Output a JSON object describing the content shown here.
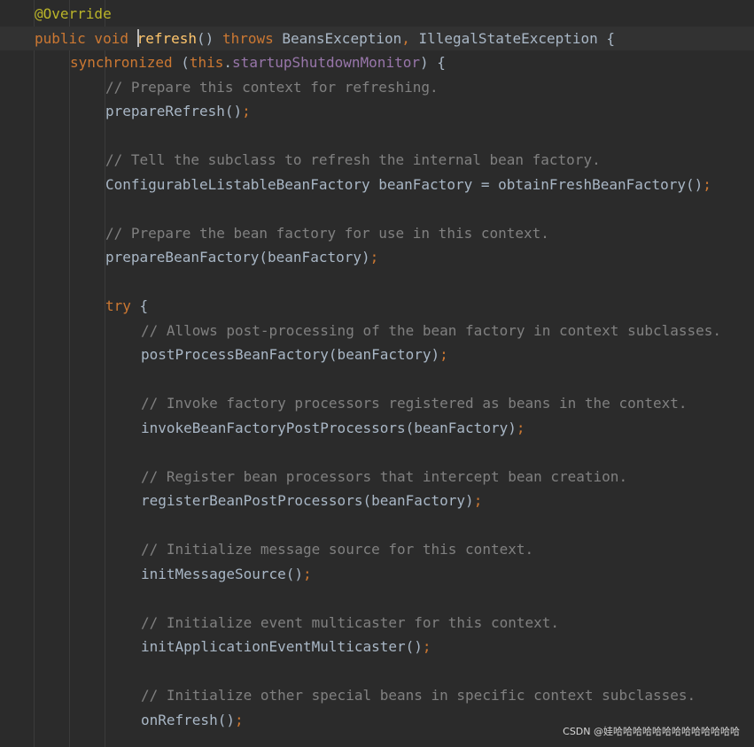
{
  "editor": {
    "theme_colors": {
      "background": "#2b2b2b",
      "current_line": "#323232",
      "plain": "#a9b7c6",
      "keyword": "#cc7832",
      "annotation": "#bbb529",
      "method_declaration": "#ffc66d",
      "field": "#9876aa",
      "comment": "#808080"
    },
    "lines": [
      {
        "indent": 1,
        "tokens": [
          {
            "t": "@Override",
            "k": "annotation"
          }
        ]
      },
      {
        "indent": 1,
        "current": true,
        "tokens": [
          {
            "t": "public void ",
            "k": "keyword"
          },
          {
            "t": "",
            "k": "caret"
          },
          {
            "t": "refresh",
            "k": "method-decl"
          },
          {
            "t": "() ",
            "k": "plain"
          },
          {
            "t": "throws ",
            "k": "keyword"
          },
          {
            "t": "BeansException",
            "k": "plain"
          },
          {
            "t": ", ",
            "k": "punct"
          },
          {
            "t": "IllegalStateException {",
            "k": "plain"
          }
        ]
      },
      {
        "indent": 2,
        "tokens": [
          {
            "t": "synchronized ",
            "k": "keyword"
          },
          {
            "t": "(",
            "k": "plain"
          },
          {
            "t": "this",
            "k": "keyword"
          },
          {
            "t": ".",
            "k": "plain"
          },
          {
            "t": "startupShutdownMonitor",
            "k": "field"
          },
          {
            "t": ") {",
            "k": "plain"
          }
        ]
      },
      {
        "indent": 3,
        "tokens": [
          {
            "t": "// Prepare this context for refreshing.",
            "k": "comment"
          }
        ]
      },
      {
        "indent": 3,
        "tokens": [
          {
            "t": "prepareRefresh()",
            "k": "plain"
          },
          {
            "t": ";",
            "k": "punct"
          }
        ]
      },
      {
        "indent": 3,
        "tokens": []
      },
      {
        "indent": 3,
        "tokens": [
          {
            "t": "// Tell the subclass to refresh the internal bean factory.",
            "k": "comment"
          }
        ]
      },
      {
        "indent": 3,
        "tokens": [
          {
            "t": "ConfigurableListableBeanFactory beanFactory = obtainFreshBeanFactory()",
            "k": "plain"
          },
          {
            "t": ";",
            "k": "punct"
          }
        ]
      },
      {
        "indent": 3,
        "tokens": []
      },
      {
        "indent": 3,
        "tokens": [
          {
            "t": "// Prepare the bean factory for use in this context.",
            "k": "comment"
          }
        ]
      },
      {
        "indent": 3,
        "tokens": [
          {
            "t": "prepareBeanFactory(beanFactory)",
            "k": "plain"
          },
          {
            "t": ";",
            "k": "punct"
          }
        ]
      },
      {
        "indent": 3,
        "tokens": []
      },
      {
        "indent": 3,
        "tokens": [
          {
            "t": "try ",
            "k": "keyword"
          },
          {
            "t": "{",
            "k": "plain"
          }
        ]
      },
      {
        "indent": 4,
        "tokens": [
          {
            "t": "// Allows post-processing of the bean factory in context subclasses.",
            "k": "comment"
          }
        ]
      },
      {
        "indent": 4,
        "tokens": [
          {
            "t": "postProcessBeanFactory(beanFactory)",
            "k": "plain"
          },
          {
            "t": ";",
            "k": "punct"
          }
        ]
      },
      {
        "indent": 4,
        "tokens": []
      },
      {
        "indent": 4,
        "tokens": [
          {
            "t": "// Invoke factory processors registered as beans in the context.",
            "k": "comment"
          }
        ]
      },
      {
        "indent": 4,
        "tokens": [
          {
            "t": "invokeBeanFactoryPostProcessors(beanFactory)",
            "k": "plain"
          },
          {
            "t": ";",
            "k": "punct"
          }
        ]
      },
      {
        "indent": 4,
        "tokens": []
      },
      {
        "indent": 4,
        "tokens": [
          {
            "t": "// Register bean processors that intercept bean creation.",
            "k": "comment"
          }
        ]
      },
      {
        "indent": 4,
        "tokens": [
          {
            "t": "registerBeanPostProcessors(beanFactory)",
            "k": "plain"
          },
          {
            "t": ";",
            "k": "punct"
          }
        ]
      },
      {
        "indent": 4,
        "tokens": []
      },
      {
        "indent": 4,
        "tokens": [
          {
            "t": "// Initialize message source for this context.",
            "k": "comment"
          }
        ]
      },
      {
        "indent": 4,
        "tokens": [
          {
            "t": "initMessageSource()",
            "k": "plain"
          },
          {
            "t": ";",
            "k": "punct"
          }
        ]
      },
      {
        "indent": 4,
        "tokens": []
      },
      {
        "indent": 4,
        "tokens": [
          {
            "t": "// Initialize event multicaster for this context.",
            "k": "comment"
          }
        ]
      },
      {
        "indent": 4,
        "tokens": [
          {
            "t": "initApplicationEventMulticaster()",
            "k": "plain"
          },
          {
            "t": ";",
            "k": "punct"
          }
        ]
      },
      {
        "indent": 4,
        "tokens": []
      },
      {
        "indent": 4,
        "tokens": [
          {
            "t": "// Initialize other special beans in specific context subclasses.",
            "k": "comment"
          }
        ]
      },
      {
        "indent": 4,
        "tokens": [
          {
            "t": "onRefresh()",
            "k": "plain"
          },
          {
            "t": ";",
            "k": "punct"
          }
        ]
      }
    ]
  },
  "watermark": "CSDN @娃哈哈哈哈哈哈哈哈哈哈哈哈哈"
}
